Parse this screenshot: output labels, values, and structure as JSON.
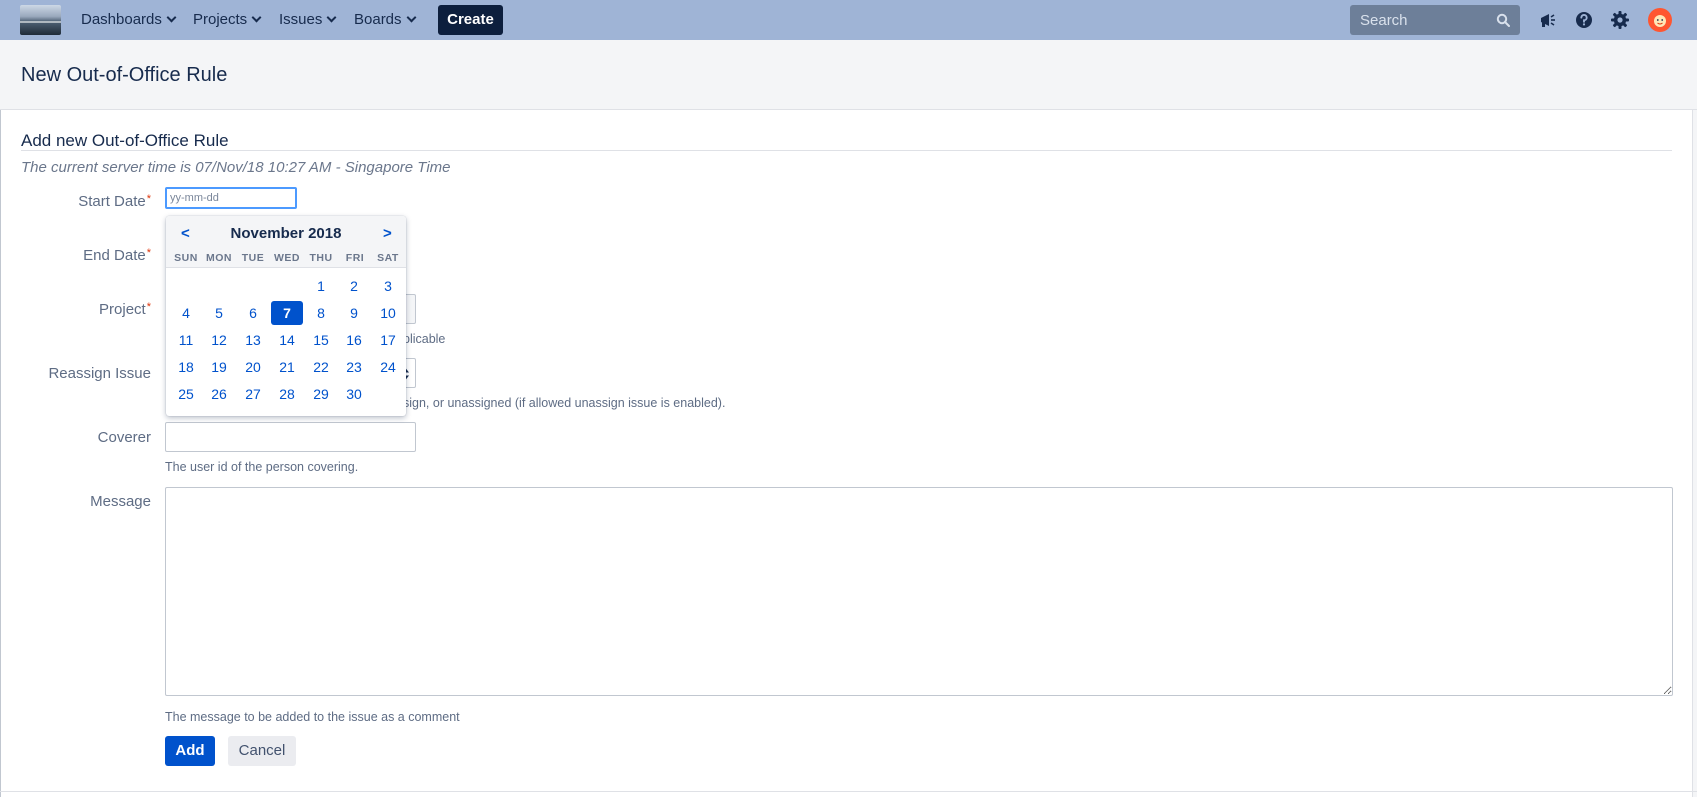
{
  "nav": {
    "items": [
      {
        "label": "Dashboards"
      },
      {
        "label": "Projects"
      },
      {
        "label": "Issues"
      },
      {
        "label": "Boards"
      }
    ],
    "create_label": "Create",
    "search_placeholder": "Search",
    "icons": [
      "megaphone-icon",
      "help-icon",
      "settings-icon",
      "avatar"
    ]
  },
  "page": {
    "title": "New Out-of-Office Rule",
    "section_title": "Add new Out-of-Office Rule",
    "server_time": "The current server time is 07/Nov/18 10:27 AM - Singapore Time"
  },
  "form": {
    "start_date": {
      "label": "Start Date",
      "required_mark": "*",
      "placeholder": "yy-mm-dd",
      "value": ""
    },
    "end_date": {
      "label": "End Date",
      "required_mark": "*"
    },
    "project": {
      "label": "Project",
      "required_mark": "*",
      "desc_partial": "plicable"
    },
    "reassign": {
      "label": "Reassign Issue",
      "desc_partial": "sign, or unassigned (if allowed unassign issue is enabled)."
    },
    "coverer": {
      "label": "Coverer",
      "value": "",
      "desc": "The user id of the person covering."
    },
    "message": {
      "label": "Message",
      "value": "",
      "desc": "The message to be added to the issue as a comment"
    },
    "add_label": "Add",
    "cancel_label": "Cancel"
  },
  "calendar": {
    "prev": "<",
    "next": ">",
    "title": "November 2018",
    "weekdays": [
      "SUN",
      "MON",
      "TUE",
      "WED",
      "THU",
      "FRI",
      "SAT"
    ],
    "first_weekday_index": 4,
    "days_in_month": 30,
    "selected_day": 7
  },
  "colors": {
    "topbar": "#9fb4d6",
    "primary": "#0052cc",
    "create_button": "#0d1f3d",
    "required": "#de350b"
  }
}
